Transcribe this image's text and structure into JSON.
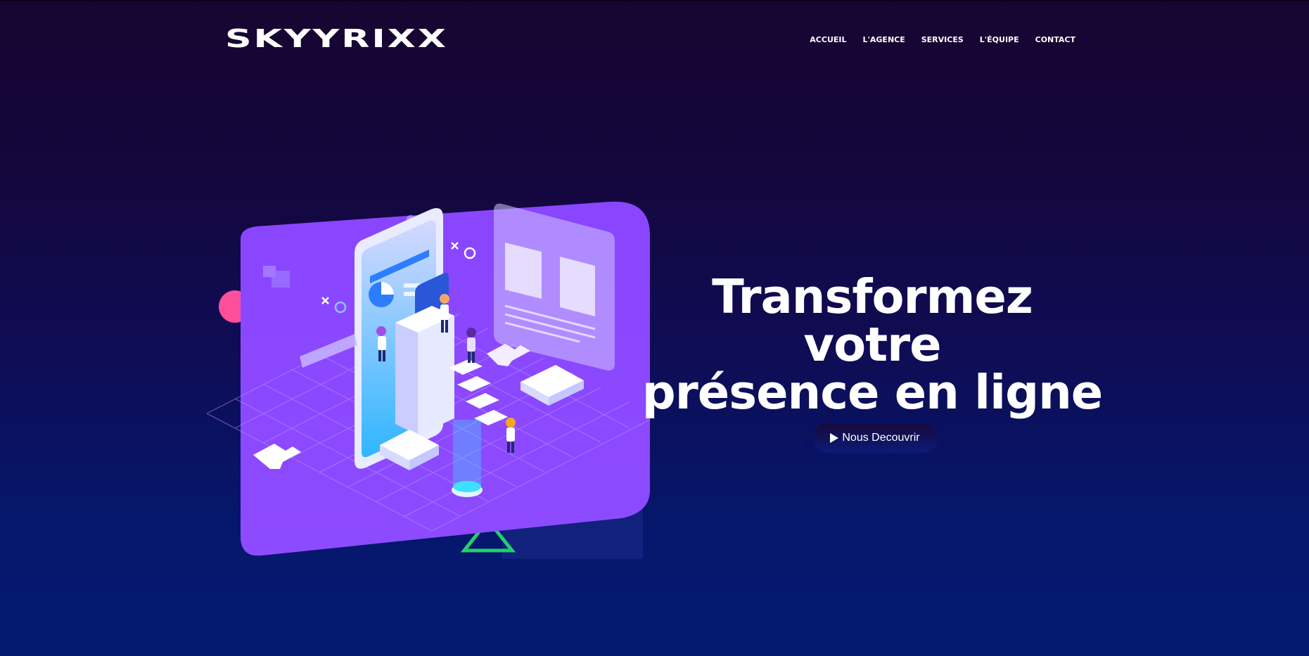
{
  "brand": {
    "name": "SKYYRIXX"
  },
  "nav": {
    "items": [
      {
        "label": "ACCUEIL"
      },
      {
        "label": "L'AGENCE"
      },
      {
        "label": "SERVICES"
      },
      {
        "label": "L'ÉQUIPE"
      },
      {
        "label": "CONTACT"
      }
    ]
  },
  "hero": {
    "title_line1": "Transformez votre",
    "title_line2": "présence en ligne",
    "cta_label": "Nous Decouvrir",
    "cta_icon": "play-icon",
    "illustration": "isometric-digital-agency-illustration"
  },
  "colors": {
    "background_top": "#170531",
    "background_bottom": "#041a72",
    "card_purple": "#8a45ff",
    "accent_pink": "#ff4f9a",
    "accent_green": "#22cf6a",
    "accent_cyan": "#3fe0ff",
    "text": "#ffffff"
  }
}
